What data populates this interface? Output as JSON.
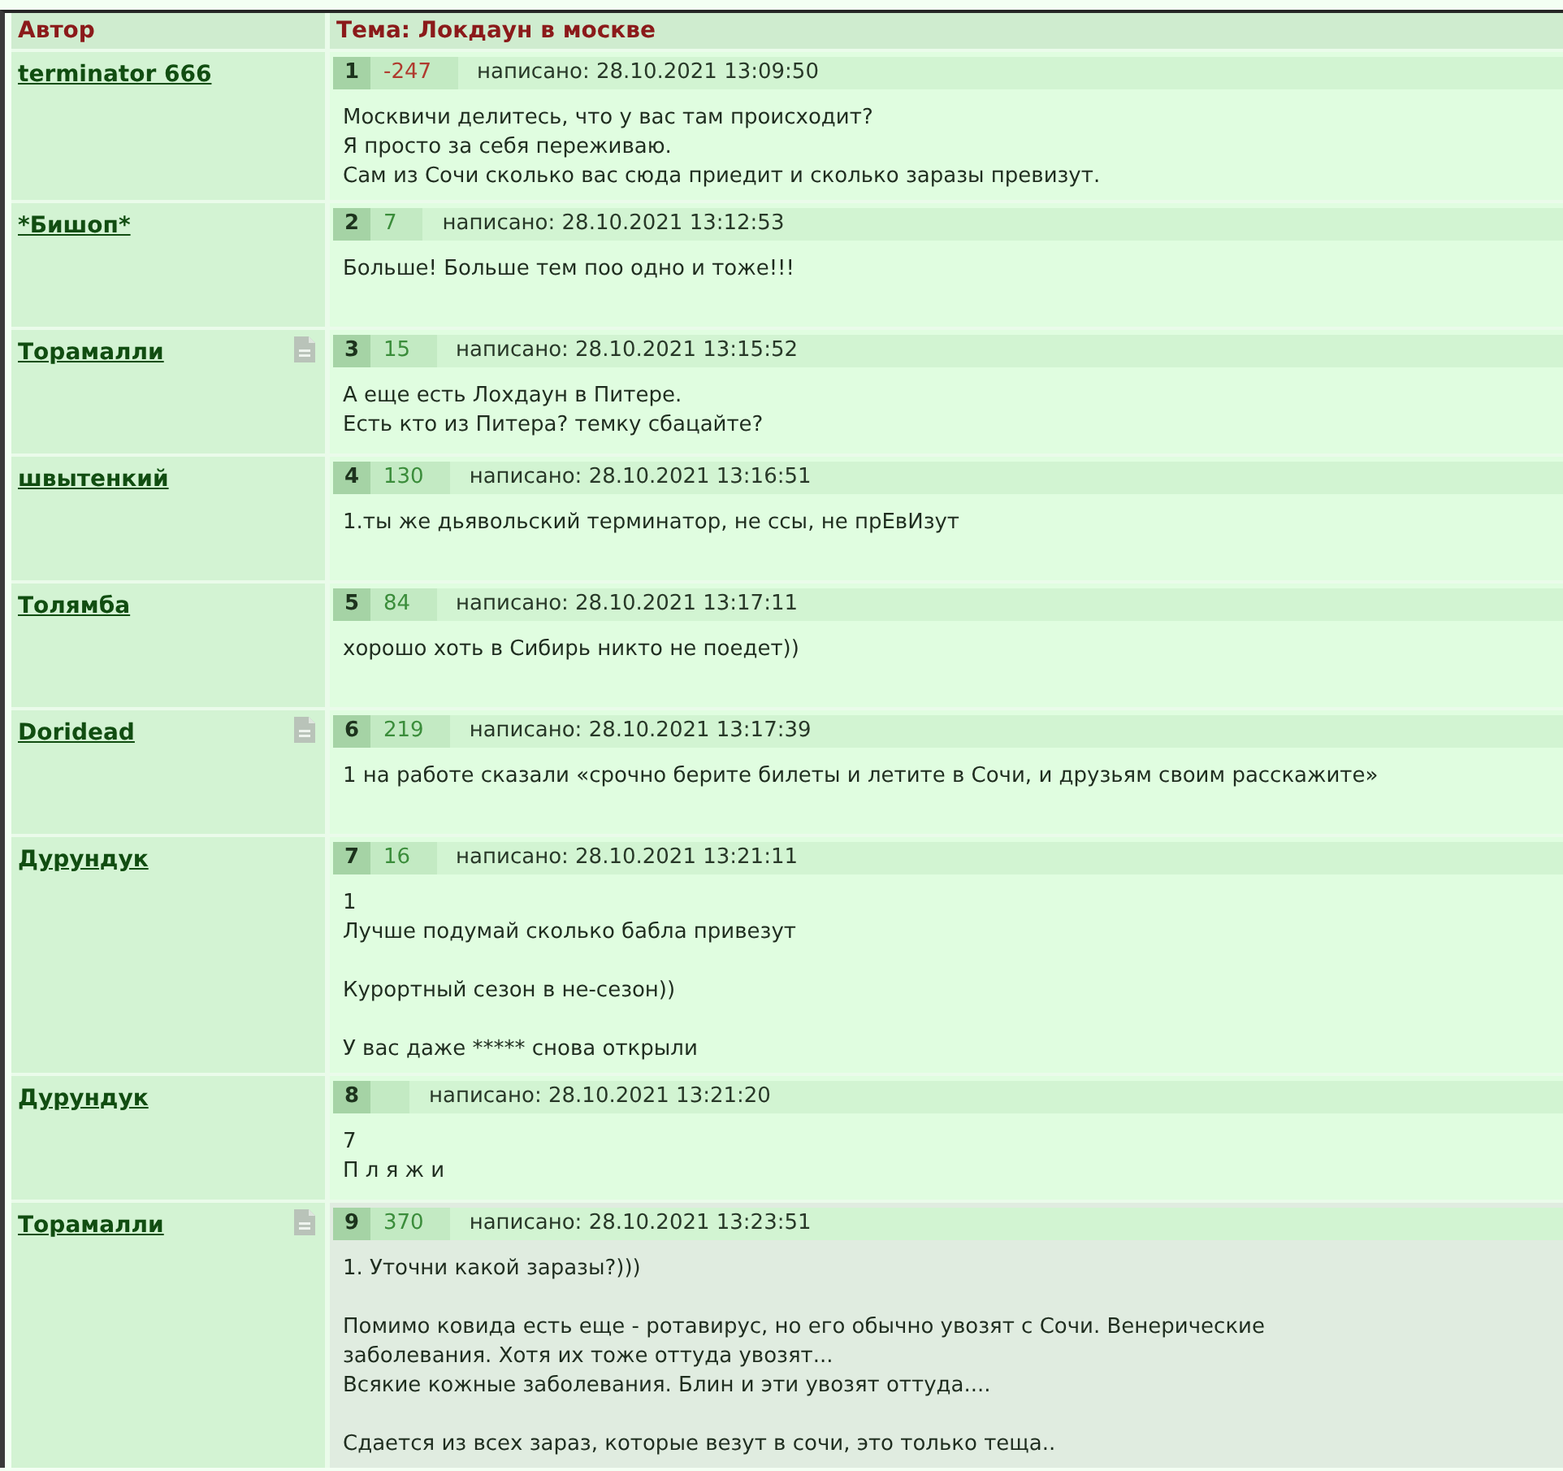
{
  "header": {
    "author_column": "Автор",
    "topic": "Тема: Локдаун в москве"
  },
  "posts": [
    {
      "author": "terminator 666",
      "file_icon": false,
      "number": "1",
      "rating": {
        "text": "-247",
        "color": "#b03a2e"
      },
      "date": "написано: 28.10.2021 13:09:50",
      "text": "Москвичи делитесь, что у вас там происходит?\nЯ просто за себя переживаю.\nСам из Сочи сколько вас сюда приедит и сколько заразы превизут.",
      "highlighted": false
    },
    {
      "author": "*Бишоп*",
      "file_icon": false,
      "number": "2",
      "rating": {
        "text": "7",
        "color": "#3b8d3b"
      },
      "date": "написано: 28.10.2021 13:12:53",
      "text": "Больше! Больше тем поо одно и тоже!!!",
      "highlighted": false
    },
    {
      "author": "Торамалли",
      "file_icon": true,
      "number": "3",
      "rating": {
        "text": "15",
        "color": "#3b8d3b"
      },
      "date": "написано: 28.10.2021 13:15:52",
      "text": "А еще есть Лохдаун в Питере.\nЕсть кто из Питера? темку сбацайте?",
      "highlighted": false
    },
    {
      "author": "швытенкий",
      "file_icon": false,
      "number": "4",
      "rating": {
        "text": "130",
        "color": "#3b8d3b"
      },
      "date": "написано: 28.10.2021 13:16:51",
      "text": "1.ты же дьявольский терминатор, не ссы, не прЕвИзут",
      "highlighted": false
    },
    {
      "author": "Толямба",
      "file_icon": false,
      "number": "5",
      "rating": {
        "text": "84",
        "color": "#3b8d3b"
      },
      "date": "написано: 28.10.2021 13:17:11",
      "text": "хорошо хоть в Сибирь никто не поедет))",
      "highlighted": false
    },
    {
      "author": "Doridead",
      "file_icon": true,
      "number": "6",
      "rating": {
        "text": "219",
        "color": "#3b8d3b"
      },
      "date": "написано: 28.10.2021 13:17:39",
      "text": "1 на работе сказали «срочно берите билеты и летите в Сочи, и друзьям своим расскажите»",
      "highlighted": false
    },
    {
      "author": "Дурундук",
      "file_icon": false,
      "number": "7",
      "rating": {
        "text": "16",
        "color": "#3b8d3b"
      },
      "date": "написано: 28.10.2021 13:21:11",
      "text": "1\nЛучше подумай сколько бабла привезут\n\nКурортный сезон в не-сезон))\n\nУ вас даже ***** снова открыли",
      "highlighted": false
    },
    {
      "author": "Дурундук",
      "file_icon": false,
      "number": "8",
      "date": "написано: 28.10.2021 13:21:20",
      "text": "7\nП л я ж и",
      "highlighted": false
    },
    {
      "author": "Торамалли",
      "file_icon": true,
      "number": "9",
      "rating": {
        "text": "370",
        "color": "#3b8d3b"
      },
      "date": "написано: 28.10.2021 13:23:51",
      "text": "1. Уточни какой заразы?)))\n\nПомимо ковида есть еще - ротавирус, но его обычно увозят с Сочи. Венерические\nзаболевания. Хотя их тоже оттуда увозят...\nВсякие кожные заболевания. Блин и эти увозят оттуда....\n\nСдается из всех зараз, которые везут в сочи, это только теща..",
      "highlighted": true
    }
  ]
}
